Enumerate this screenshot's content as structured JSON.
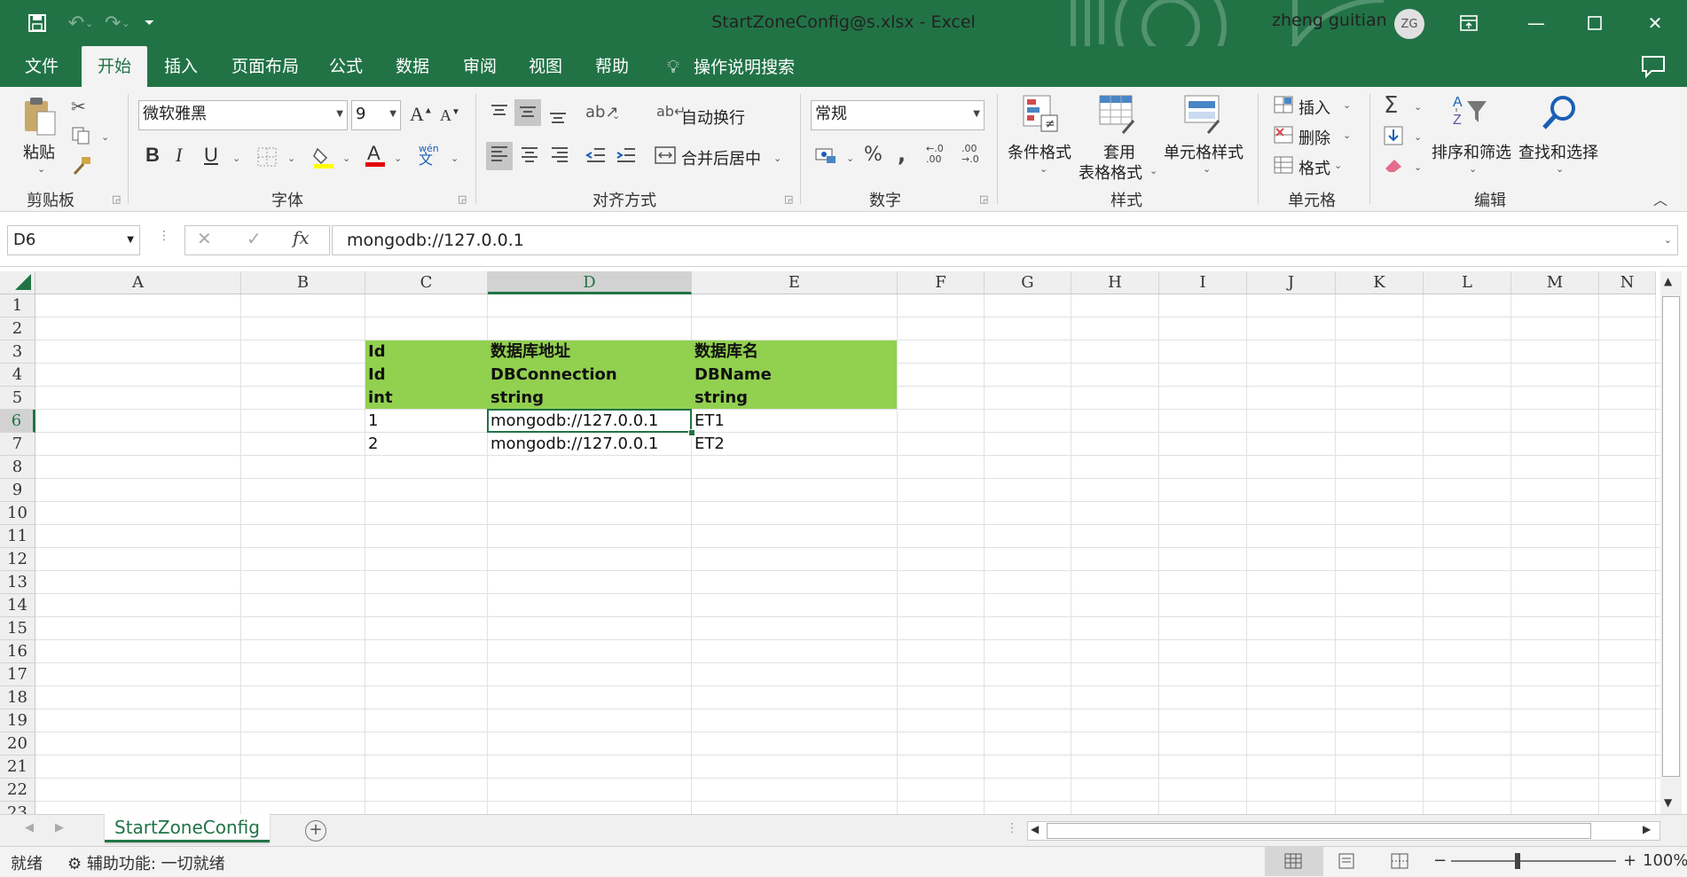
{
  "window": {
    "title": "StartZoneConfig@s.xlsx  -  Excel",
    "user_name": "zheng guitian",
    "user_initials": "ZG",
    "accent_color": "#217346"
  },
  "menu": {
    "tabs": [
      "文件",
      "开始",
      "插入",
      "页面布局",
      "公式",
      "数据",
      "审阅",
      "视图",
      "帮助"
    ],
    "active_tab": "开始",
    "tell_me": "操作说明搜索"
  },
  "ribbon": {
    "clipboard": {
      "paste": "粘贴",
      "group": "剪贴板"
    },
    "font": {
      "name": "微软雅黑",
      "size": "9",
      "group": "字体"
    },
    "alignment": {
      "wrap": "自动换行",
      "merge": "合并后居中",
      "group": "对齐方式"
    },
    "number": {
      "format": "常规",
      "group": "数字"
    },
    "styles": {
      "conditional": "条件格式",
      "table_line1": "套用",
      "table_line2": "表格格式",
      "cell_styles": "单元格样式",
      "group": "样式"
    },
    "cells": {
      "insert": "插入",
      "delete": "删除",
      "format": "格式",
      "group": "单元格"
    },
    "editing": {
      "sort": "排序和筛选",
      "find": "查找和选择",
      "group": "编辑"
    }
  },
  "formula_bar": {
    "name_box": "D6",
    "formula": "mongodb://127.0.0.1"
  },
  "sheet": {
    "columns": [
      "A",
      "B",
      "C",
      "D",
      "E",
      "F",
      "G",
      "H",
      "I",
      "J",
      "K",
      "L",
      "M",
      "N"
    ],
    "rows": [
      "1",
      "2",
      "3",
      "4",
      "5",
      "6",
      "7",
      "8",
      "9",
      "10",
      "11",
      "12",
      "13",
      "14",
      "15",
      "16",
      "17",
      "18",
      "19",
      "20",
      "21",
      "22",
      "23"
    ],
    "selected_cell": "D6",
    "header_fill_color": "#92d050",
    "cells": {
      "C3": "Id",
      "D3": "数据库地址",
      "E3": "数据库名",
      "C4": "Id",
      "D4": "DBConnection",
      "E4": "DBName",
      "C5": "int",
      "D5": "string",
      "E5": "string",
      "C6": "1",
      "D6": "mongodb://127.0.0.1",
      "E6": "ET1",
      "C7": "2",
      "D7": "mongodb://127.0.0.1",
      "E7": "ET2"
    }
  },
  "sheet_tabs": {
    "active": "StartZoneConfig"
  },
  "status": {
    "ready": "就绪",
    "accessibility": "辅助功能: 一切就绪",
    "zoom": "100%"
  }
}
